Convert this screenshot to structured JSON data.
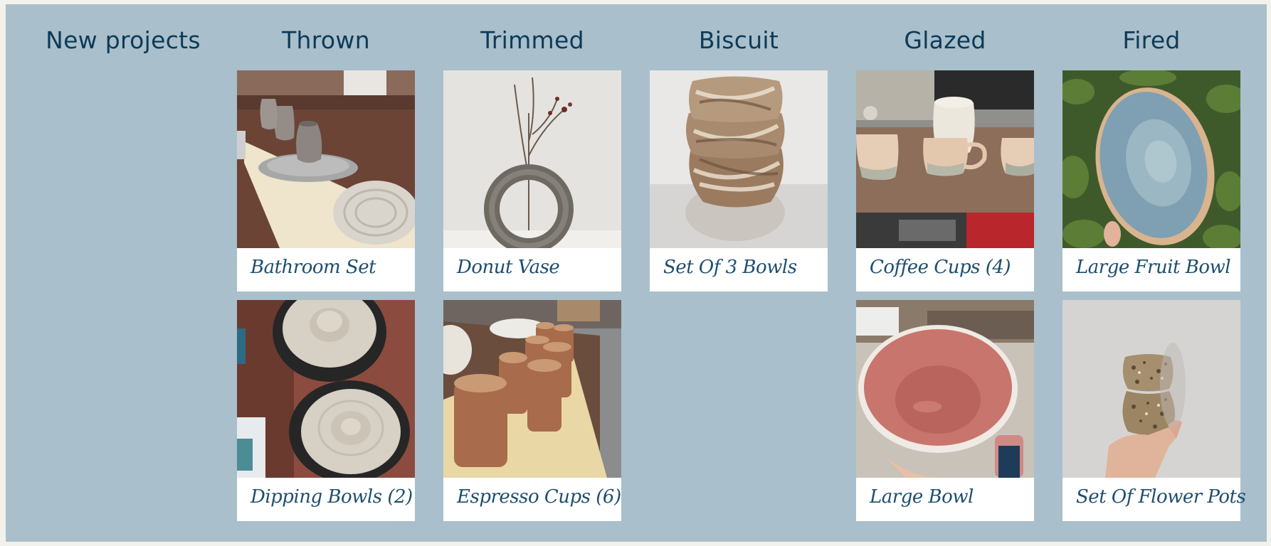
{
  "columns": [
    {
      "title": "New projects",
      "cards": []
    },
    {
      "title": "Thrown",
      "cards": [
        {
          "label": "Bathroom Set",
          "photo": "thrown-tumblers-photo"
        },
        {
          "label": "Dipping Bowls (2)",
          "photo": "dipping-bowls-photo"
        }
      ]
    },
    {
      "title": "Trimmed",
      "cards": [
        {
          "label": "Donut Vase",
          "photo": "donut-vase-photo"
        },
        {
          "label": "Espresso Cups (6)",
          "photo": "espresso-cups-photo"
        }
      ]
    },
    {
      "title": "Biscuit",
      "cards": [
        {
          "label": "Set Of 3 Bowls",
          "photo": "stacked-bowls-photo"
        }
      ]
    },
    {
      "title": "Glazed",
      "cards": [
        {
          "label": "Coffee Cups (4)",
          "photo": "coffee-cups-photo"
        },
        {
          "label": "Large Bowl",
          "photo": "pink-bowl-photo"
        }
      ]
    },
    {
      "title": "Fired",
      "cards": [
        {
          "label": "Large Fruit Bowl",
          "photo": "blue-fruit-bowl-photo"
        },
        {
          "label": "Set Of Flower Pots",
          "photo": "speckled-pots-photo"
        }
      ]
    }
  ],
  "colors": {
    "board": "#a9bfcb",
    "title": "#0d3a57",
    "label": "#1d4e6e",
    "card": "#ffffff"
  }
}
